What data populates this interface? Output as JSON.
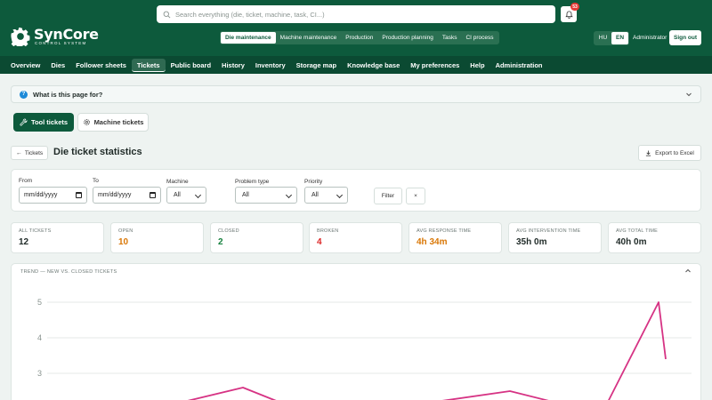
{
  "app": {
    "name": "SynCore",
    "subtitle": "CONTROL SYSTEM"
  },
  "search": {
    "placeholder": "Search everything (die, ticket, machine, task, CI...)"
  },
  "notifications": {
    "count": "53"
  },
  "modules": [
    {
      "label": "Die maintenance",
      "active": true
    },
    {
      "label": "Machine maintenance",
      "active": false
    },
    {
      "label": "Production",
      "active": false
    },
    {
      "label": "Production planning",
      "active": false
    },
    {
      "label": "Tasks",
      "active": false
    },
    {
      "label": "CI process",
      "active": false
    }
  ],
  "lang": {
    "hu": "HU",
    "en": "EN"
  },
  "user": {
    "name": "Administrator",
    "signout": "Sign out"
  },
  "nav": [
    {
      "label": "Overview",
      "active": false
    },
    {
      "label": "Dies",
      "active": false
    },
    {
      "label": "Follower sheets",
      "active": false
    },
    {
      "label": "Tickets",
      "active": true
    },
    {
      "label": "Public board",
      "active": false
    },
    {
      "label": "History",
      "active": false
    },
    {
      "label": "Inventory",
      "active": false
    },
    {
      "label": "Storage map",
      "active": false
    },
    {
      "label": "Knowledge base",
      "active": false
    },
    {
      "label": "My preferences",
      "active": false
    },
    {
      "label": "Help",
      "active": false
    },
    {
      "label": "Administration",
      "active": false
    }
  ],
  "info": {
    "icon": "?",
    "text": "What is this page for?"
  },
  "ticket_tabs": {
    "tool": "Tool tickets",
    "machine": "Machine tickets"
  },
  "page": {
    "back": "Tickets",
    "title": "Die ticket statistics",
    "export": "Export to Excel"
  },
  "filters": {
    "from_label": "From",
    "from_value": "mm/dd/yyyy",
    "to_label": "To",
    "to_value": "mm/dd/yyyy",
    "machine_label": "Machine",
    "machine_value": "All",
    "problem_label": "Problem type",
    "problem_value": "All",
    "priority_label": "Priority",
    "priority_value": "All",
    "filter_button": "Filter",
    "clear_button": "×"
  },
  "stats": [
    {
      "label": "ALL TICKETS",
      "value": "12",
      "color": "#1f2a27"
    },
    {
      "label": "OPEN",
      "value": "10",
      "color": "#d97706"
    },
    {
      "label": "CLOSED",
      "value": "2",
      "color": "#15803d"
    },
    {
      "label": "BROKEN",
      "value": "4",
      "color": "#dc2626"
    },
    {
      "label": "AVG RESPONSE TIME",
      "value": "4h 34m",
      "color": "#d97706"
    },
    {
      "label": "AVG INTERVENTION TIME",
      "value": "35h 0m",
      "color": "#1f2a27"
    },
    {
      "label": "AVG TOTAL TIME",
      "value": "40h 0m",
      "color": "#1f2a27"
    }
  ],
  "trend": {
    "title": "TREND — NEW VS. CLOSED TICKETS"
  },
  "chart_data": {
    "type": "line",
    "title": "TREND — NEW VS. CLOSED TICKETS",
    "y_ticks": [
      "5",
      "4",
      "3"
    ],
    "ylim": [
      2,
      5
    ],
    "grid": true,
    "series": [
      {
        "values": [
          2,
          2,
          2.6,
          2,
          2,
          2.5,
          2,
          2,
          5,
          3.4
        ],
        "color": "#d63384"
      }
    ]
  },
  "colors": {
    "brand": "#0d5a3c",
    "nav": "#0b4a32",
    "accent_line": "#d63384"
  }
}
